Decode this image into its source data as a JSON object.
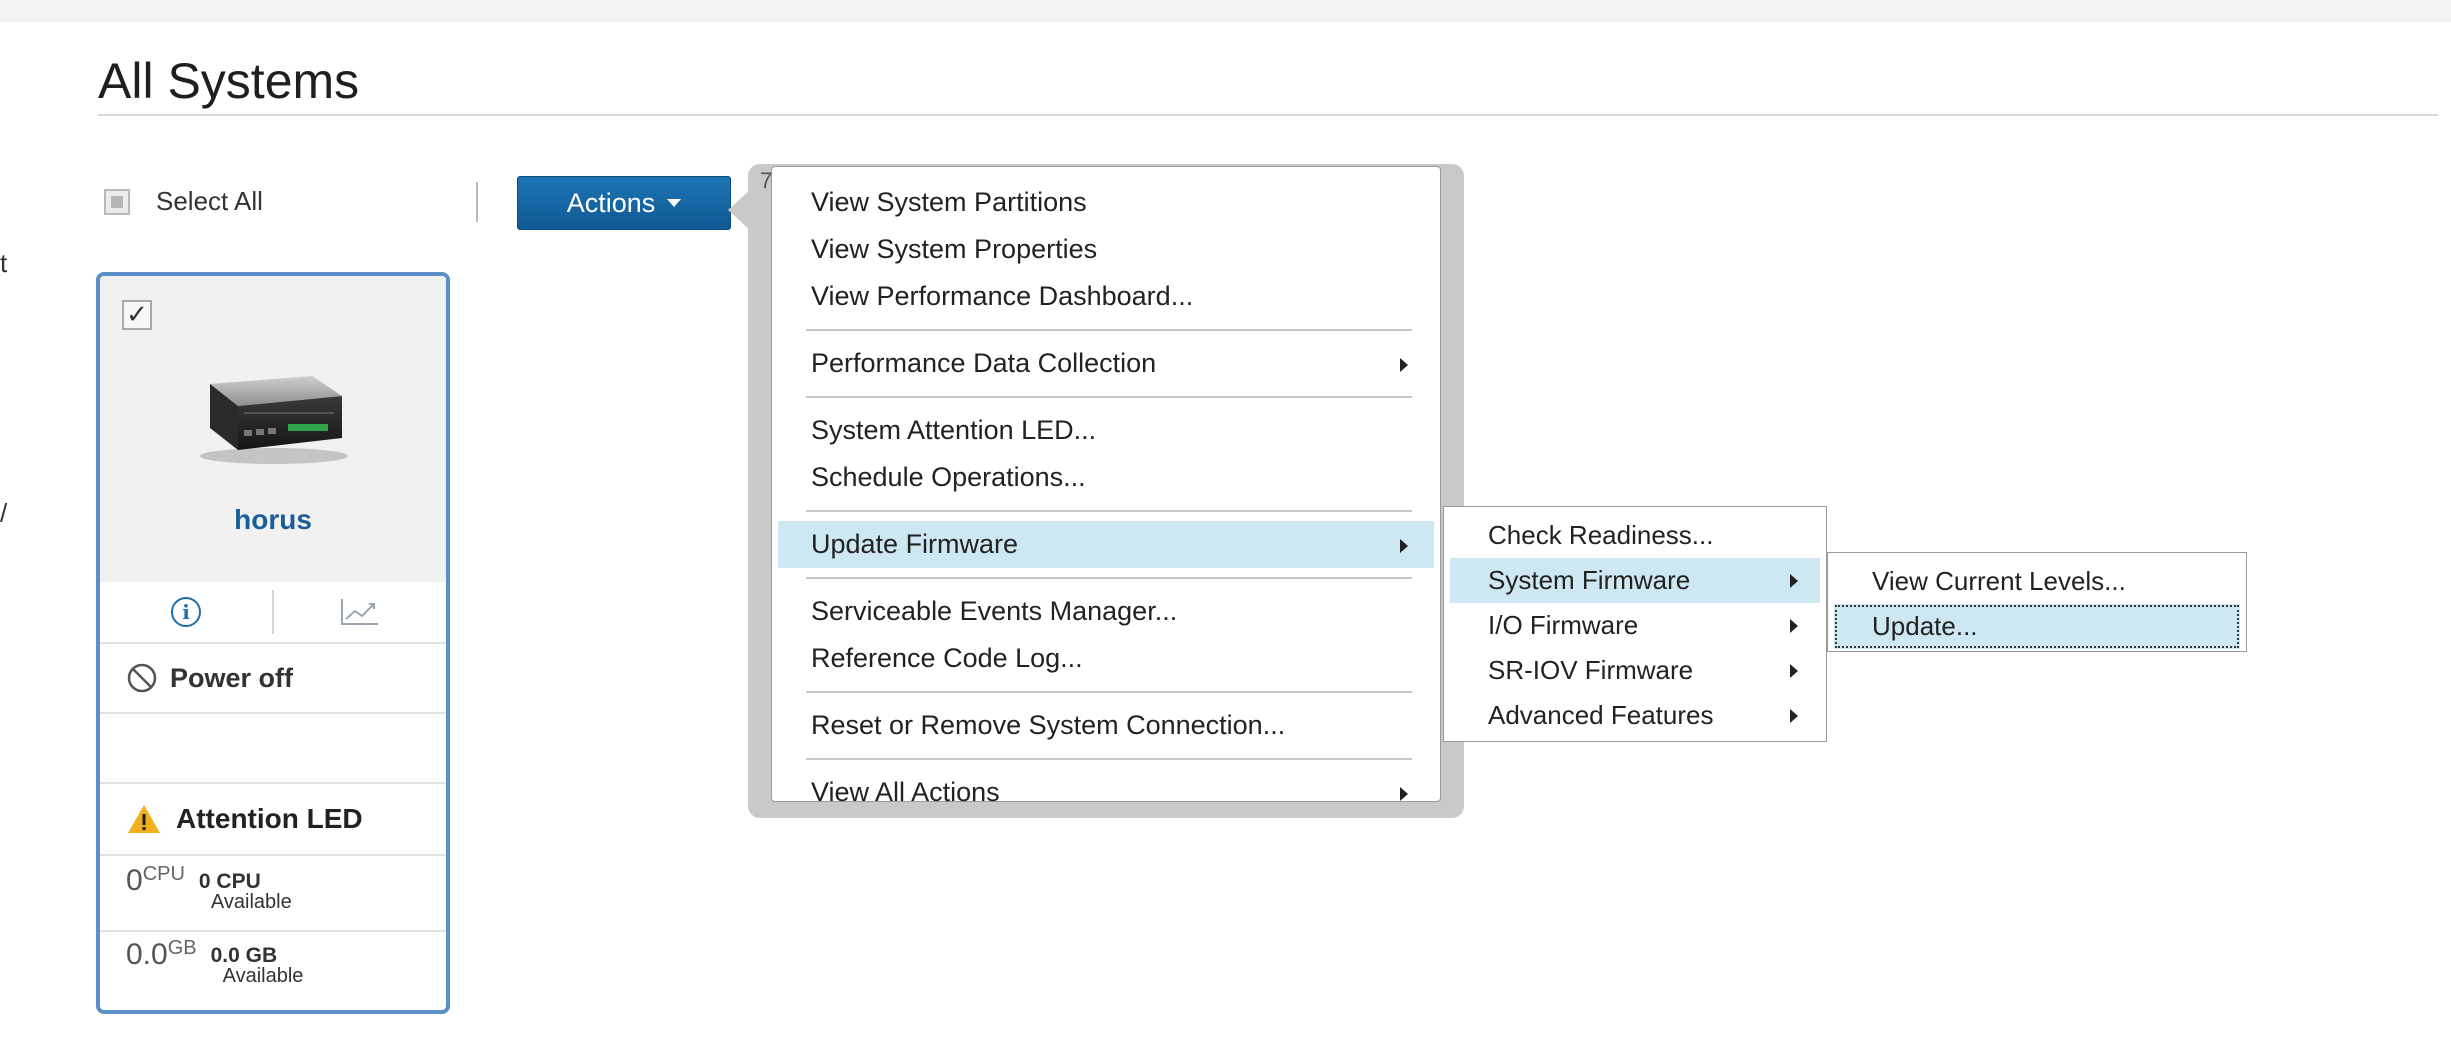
{
  "page": {
    "title": "All Systems",
    "left_stub_1": "t",
    "left_stub_2": "/"
  },
  "toolbar": {
    "select_all_label": "Select All",
    "actions_label": "Actions"
  },
  "system_card": {
    "name": "horus",
    "power_status": "Power off",
    "attention": "Attention LED",
    "cpu_value": "0",
    "cpu_unit": "CPU",
    "cpu_available_value": "0 CPU",
    "cpu_available_label": "Available",
    "mem_value": "0.0",
    "mem_unit": "GB",
    "mem_available_value": "0.0 GB",
    "mem_available_label": "Available"
  },
  "actions_menu": {
    "pointer_label": "7",
    "items": [
      "View System Partitions",
      "View System Properties",
      "View Performance Dashboard...",
      "Performance Data Collection",
      "System Attention LED...",
      "Schedule Operations...",
      "Update Firmware",
      "Serviceable Events Manager...",
      "Reference Code Log...",
      "Reset or Remove System Connection...",
      "View All Actions"
    ]
  },
  "firmware_menu": {
    "items": [
      "Check Readiness...",
      "System Firmware",
      "I/O Firmware",
      "SR-IOV Firmware",
      "Advanced Features"
    ]
  },
  "system_firmware_menu": {
    "items": [
      "View Current Levels...",
      "Update..."
    ]
  },
  "colors": {
    "accent": "#1d6fb0",
    "menu_highlight": "#cde7f3",
    "card_border": "#5b8fc6",
    "warning": "#f2b01e"
  }
}
